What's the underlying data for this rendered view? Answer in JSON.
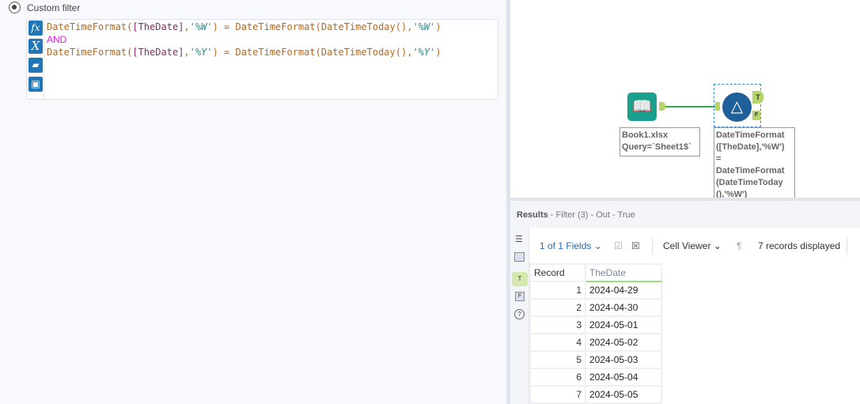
{
  "filter": {
    "option_label": "Custom filter",
    "expression_lines": [
      [
        {
          "t": "DateTimeFormat",
          "c": "fn"
        },
        {
          "t": "(",
          "c": "fn"
        },
        {
          "t": "[TheDate]",
          "c": "br"
        },
        {
          "t": ",",
          "c": "fn"
        },
        {
          "t": "'%W'",
          "c": "st"
        },
        {
          "t": ") = ",
          "c": "fn"
        },
        {
          "t": "DateTimeFormat(DateTimeToday(),",
          "c": "fn"
        },
        {
          "t": "'%W'",
          "c": "st"
        },
        {
          "t": ")",
          "c": "fn"
        }
      ],
      [
        {
          "t": "AND",
          "c": "kw"
        }
      ],
      [
        {
          "t": "DateTimeFormat",
          "c": "fn"
        },
        {
          "t": "(",
          "c": "fn"
        },
        {
          "t": "[TheDate]",
          "c": "br"
        },
        {
          "t": ",",
          "c": "fn"
        },
        {
          "t": "'%Y'",
          "c": "st"
        },
        {
          "t": ") = ",
          "c": "fn"
        },
        {
          "t": "DateTimeFormat(DateTimeToday(),",
          "c": "fn"
        },
        {
          "t": "'%Y'",
          "c": "st"
        },
        {
          "t": ")",
          "c": "fn"
        }
      ]
    ],
    "buttons": {
      "fx": "fx",
      "var": "X"
    }
  },
  "canvas": {
    "input_annotation": "Book1.xlsx\nQuery=`Sheet1$`",
    "filter_annotation": "DateTimeFormat\n([TheDate],'%W')\n=\nDateTimeFormat\n(DateTimeToday\n(),'%W')",
    "true_anchor": "T",
    "false_anchor": "F"
  },
  "results": {
    "title": "Results",
    "subtitle": " - Filter (3) - Out - True",
    "fields": "1 of 1 Fields",
    "viewer": "Cell Viewer",
    "records": "7 records displayed",
    "columns": [
      "Record",
      "TheDate"
    ],
    "rows": [
      [
        "1",
        "2024-04-29"
      ],
      [
        "2",
        "2024-04-30"
      ],
      [
        "3",
        "2024-05-01"
      ],
      [
        "4",
        "2024-05-02"
      ],
      [
        "5",
        "2024-05-03"
      ],
      [
        "6",
        "2024-05-04"
      ],
      [
        "7",
        "2024-05-05"
      ]
    ]
  },
  "colors": {
    "accent": "#1f77b8",
    "anchor": "#b5d56a",
    "connector": "#3aa655",
    "input_tool": "#1aa08e",
    "filter_tool": "#1f5f9a"
  }
}
